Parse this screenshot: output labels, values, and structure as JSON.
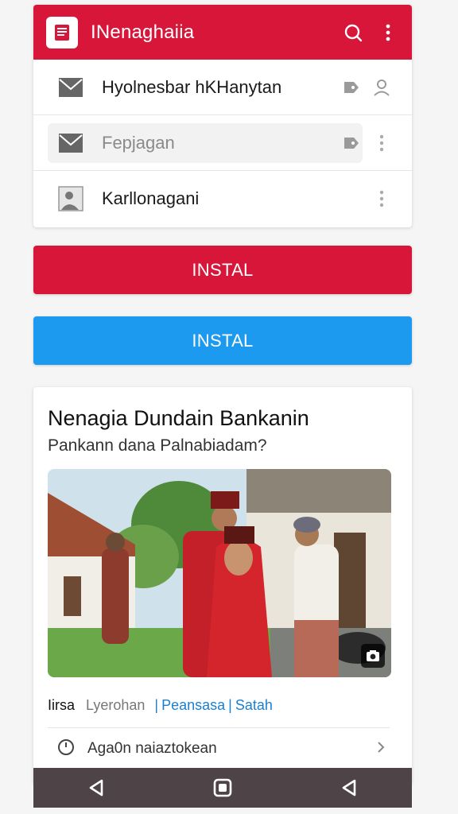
{
  "appbar": {
    "title": "INenaghaiia",
    "logo_icon": "book-icon",
    "search_icon": "search-icon",
    "menu_icon": "more-vert-icon",
    "color": "#d7163a"
  },
  "rows": [
    {
      "label": "Hyolnesbar hKHanytan",
      "icon": "mail-icon",
      "side": [
        "tag-icon",
        "person-icon"
      ]
    },
    {
      "label": "Fepjagan",
      "icon": "mail-icon",
      "side": [
        "tag-icon",
        "more-vert-icon"
      ]
    },
    {
      "label": "Karllonagani",
      "icon": "contact-image-icon",
      "side": [
        "more-vert-icon"
      ]
    }
  ],
  "buttons": {
    "install_red": "INSTAL",
    "install_blue": "INSTAL",
    "red_color": "#d7163a",
    "blue_color": "#1b9af0"
  },
  "news": {
    "title": "Nenagia Dundain Bankanin",
    "subtitle": "Pankann dana Palnabiadam?",
    "meta": {
      "source": "Iirsa",
      "time": "Lyerohan",
      "link1": "Peansasa",
      "link2": "Satah"
    },
    "footer_label": "Aga0n naiaztokean"
  },
  "navbar": {
    "back_icon": "back-icon",
    "home_icon": "home-icon",
    "recent_icon": "back-icon"
  }
}
